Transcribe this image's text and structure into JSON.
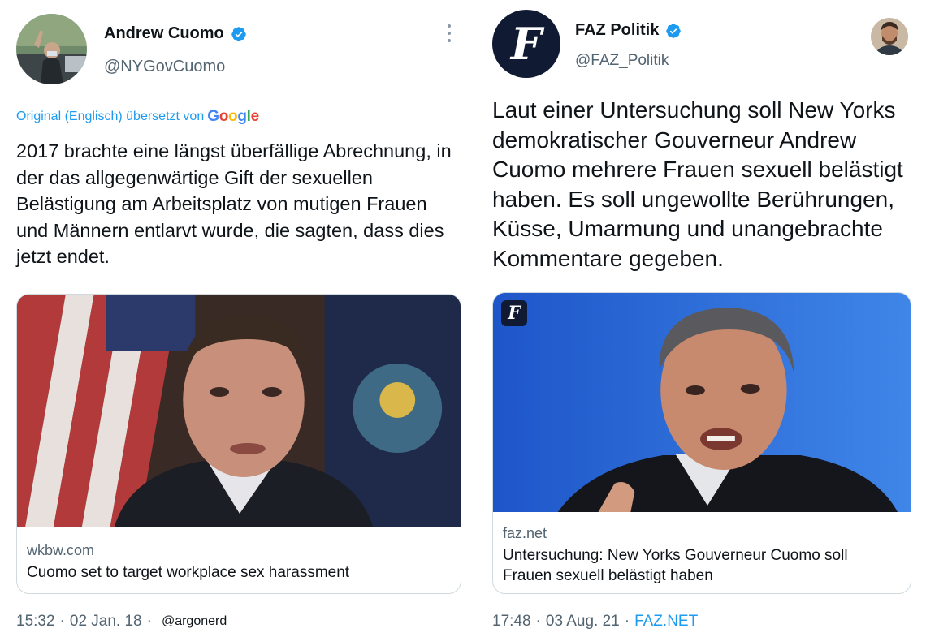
{
  "left_tweet": {
    "author": {
      "name": "Andrew Cuomo",
      "handle": "@NYGovCuomo",
      "verified": true
    },
    "translation": {
      "label": "Original (Englisch) übersetzt von",
      "provider": "Google"
    },
    "text": "2017 brachte eine längst überfällige Abrechnung, in der das allgegenwärtige Gift der sexuellen Belästigung am Arbeitsplatz von mutigen Frauen und Männern entlarvt wurde, die sagten, dass dies jetzt endet.",
    "card": {
      "domain": "wkbw.com",
      "title": "Cuomo set to target workplace sex harassment"
    },
    "meta": {
      "time": "15:32",
      "separator": "·",
      "date": "02 Jan. 18",
      "watermark": "@argonerd"
    },
    "more_icon": "more-vertical-icon"
  },
  "right_tweet": {
    "author": {
      "name": "FAZ Politik",
      "handle": "@FAZ_Politik",
      "verified": true,
      "logo_letter": "F"
    },
    "text": "Laut einer Untersuchung soll New Yorks demokratischer Gouverneur Andrew Cuomo mehrere Frauen sexuell belästigt haben. Es soll ungewollte Berührungen, Küsse, Umarmung und unangebrachte Kommentare gegeben.",
    "card": {
      "domain": "faz.net",
      "title": "Untersuchung: New Yorks Gouverneur Cuomo soll Frauen sexuell belästigt haben",
      "badge_letter": "F"
    },
    "meta": {
      "time": "17:48",
      "separator": "·",
      "date": "03 Aug. 21",
      "source": "FAZ.NET"
    }
  },
  "colors": {
    "accent": "#1d9bf0",
    "text": "#0f1419",
    "secondary": "#536471",
    "border": "#cfd9de"
  }
}
